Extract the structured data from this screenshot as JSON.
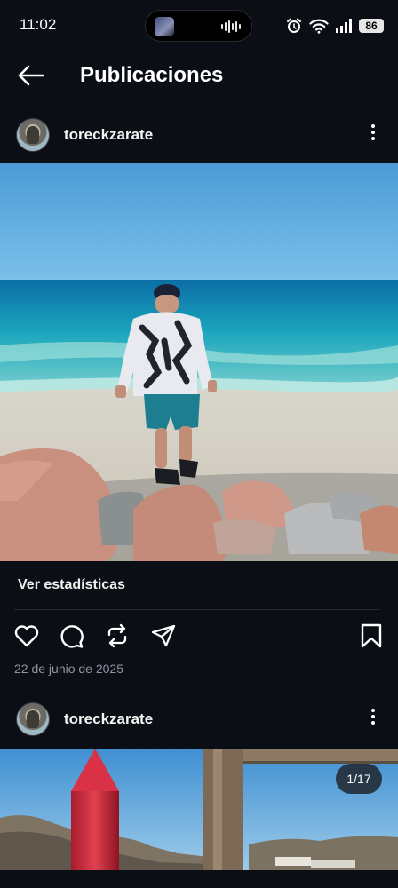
{
  "status_bar": {
    "time": "11:02",
    "battery": "86",
    "icons": [
      "island-thumbnail-icon",
      "audio-wave-icon",
      "alarm-icon",
      "wifi-icon",
      "signal-icon",
      "battery-icon"
    ]
  },
  "header": {
    "title": "Publicaciones",
    "back_icon": "back-arrow-icon"
  },
  "posts": [
    {
      "username": "toreckzarate",
      "stats_label": "Ver estadísticas",
      "date": "22 de junio de 2025",
      "actions": [
        "like-icon",
        "comment-icon",
        "repost-icon",
        "share-icon",
        "save-icon"
      ]
    },
    {
      "username": "toreckzarate",
      "carousel_counter": "1/17"
    }
  ],
  "colors": {
    "background": "#0b0e14",
    "text": "#f2f4f7",
    "muted": "#8f96a3",
    "divider": "#232833"
  }
}
